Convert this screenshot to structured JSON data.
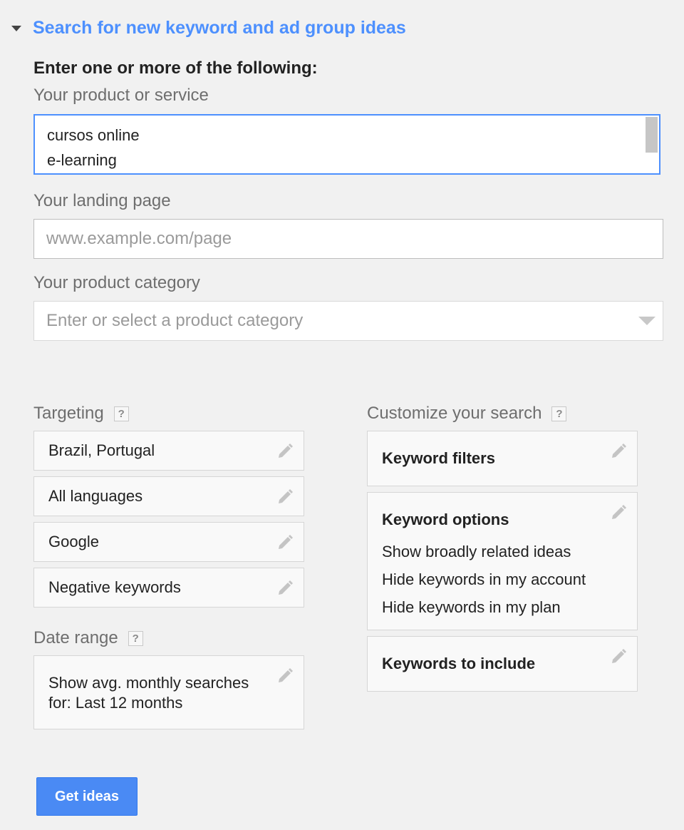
{
  "section": {
    "title": "Search for new keyword and ad group ideas"
  },
  "instructions": "Enter one or more of the following:",
  "product_service": {
    "label": "Your product or service",
    "lines": [
      "cursos online",
      "e-learning"
    ]
  },
  "landing_page": {
    "label": "Your landing page",
    "placeholder": "www.example.com/page"
  },
  "product_category": {
    "label": "Your product category",
    "placeholder": "Enter or select a product category"
  },
  "targeting": {
    "title": "Targeting",
    "help": "?",
    "items": [
      "Brazil, Portugal",
      "All languages",
      "Google",
      "Negative keywords"
    ]
  },
  "date_range": {
    "title": "Date range",
    "help": "?",
    "lines": [
      "Show avg. monthly searches",
      "for: Last 12 months"
    ]
  },
  "customize": {
    "title": "Customize your search",
    "help": "?",
    "keyword_filters": {
      "title": "Keyword filters"
    },
    "keyword_options": {
      "title": "Keyword options",
      "lines": [
        "Show broadly related ideas",
        "Hide keywords in my account",
        "Hide keywords in my plan"
      ]
    },
    "keywords_to_include": {
      "title": "Keywords to include"
    }
  },
  "get_ideas": {
    "label": "Get ideas"
  },
  "colors": {
    "accent_blue": "#4d90fe",
    "button_blue": "#4a8af4",
    "background": "#f1f1f1"
  }
}
